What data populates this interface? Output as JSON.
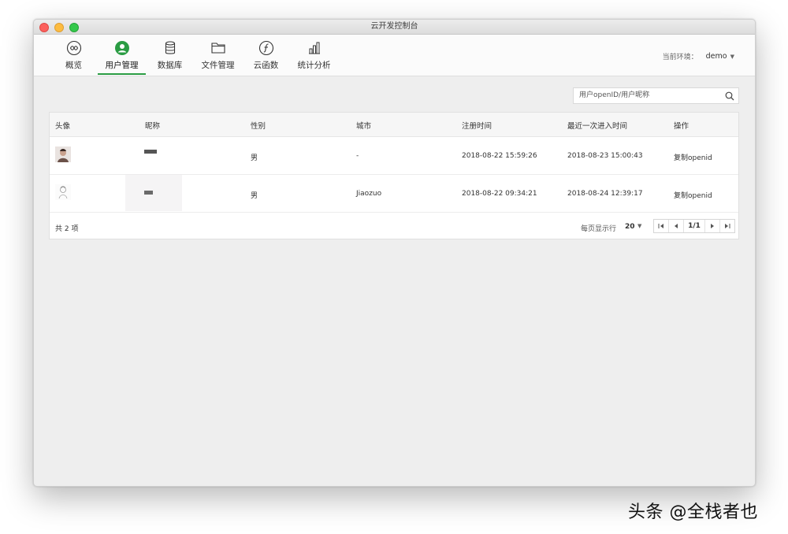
{
  "window": {
    "title": "云开发控制台"
  },
  "nav": {
    "items": [
      {
        "label": "概览",
        "icon": "overview-icon"
      },
      {
        "label": "用户管理",
        "icon": "user-icon",
        "active": true
      },
      {
        "label": "数据库",
        "icon": "database-icon"
      },
      {
        "label": "文件管理",
        "icon": "folder-icon"
      },
      {
        "label": "云函数",
        "icon": "function-icon"
      },
      {
        "label": "统计分析",
        "icon": "chart-icon"
      }
    ]
  },
  "env": {
    "label": "当前环境：",
    "value": "demo"
  },
  "search": {
    "placeholder": "用户openID/用户昵称"
  },
  "table": {
    "columns": [
      "头像",
      "昵称",
      "性别",
      "城市",
      "注册时间",
      "最近一次进入时间",
      "操作"
    ],
    "rows": [
      {
        "gender": "男",
        "city": "-",
        "registered": "2018-08-22 15:59:26",
        "last_visit": "2018-08-23 15:00:43",
        "action": "复制openid"
      },
      {
        "gender": "男",
        "city": "Jiaozuo",
        "registered": "2018-08-22 09:34:21",
        "last_visit": "2018-08-24 12:39:17",
        "action": "复制openid"
      }
    ],
    "total": "共 2 项",
    "per_page_label": "每页显示行",
    "per_page_value": "20",
    "page": "1/1"
  },
  "watermark": "头条 @全栈者也",
  "colors": {
    "accent": "#2a9c43"
  }
}
